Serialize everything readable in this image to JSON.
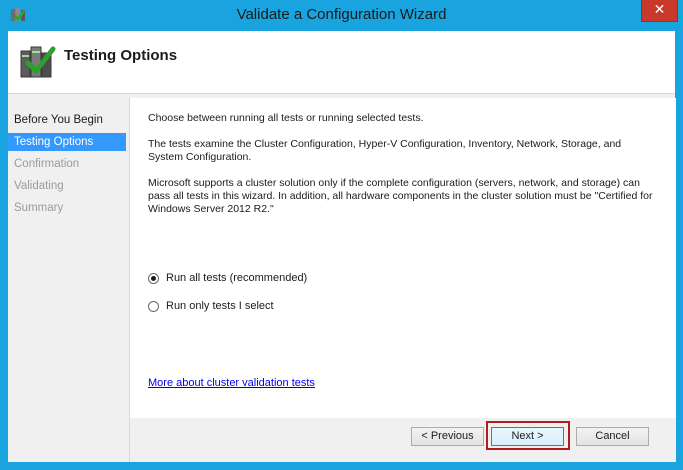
{
  "window": {
    "title": "Validate a Configuration Wizard",
    "close_glyph": "✕"
  },
  "header": {
    "title": "Testing Options"
  },
  "nav": {
    "items": [
      {
        "label": "Before You Begin",
        "state": "done"
      },
      {
        "label": "Testing Options",
        "state": "active"
      },
      {
        "label": "Confirmation",
        "state": "pending"
      },
      {
        "label": "Validating",
        "state": "pending"
      },
      {
        "label": "Summary",
        "state": "pending"
      }
    ]
  },
  "content": {
    "intro": "Choose between running all tests or running selected tests.",
    "tests_desc": "The tests examine the Cluster Configuration, Hyper-V Configuration, Inventory, Network, Storage, and System Configuration.",
    "support_desc": "Microsoft supports a cluster solution only if the complete configuration (servers, network, and storage) can pass all tests in this wizard. In addition, all hardware components in the cluster solution must be \"Certified for Windows Server 2012 R2.\"",
    "options": [
      {
        "label": "Run all tests (recommended)",
        "selected": true
      },
      {
        "label": "Run only tests I select",
        "selected": false
      }
    ],
    "link": "More about cluster validation tests"
  },
  "buttons": {
    "previous": "< Previous",
    "next": "Next >",
    "cancel": "Cancel"
  },
  "colors": {
    "window_frame": "#19a4df",
    "nav_active": "#3399ff",
    "close_button": "#c7392b",
    "highlight_box": "#b11c1c"
  }
}
